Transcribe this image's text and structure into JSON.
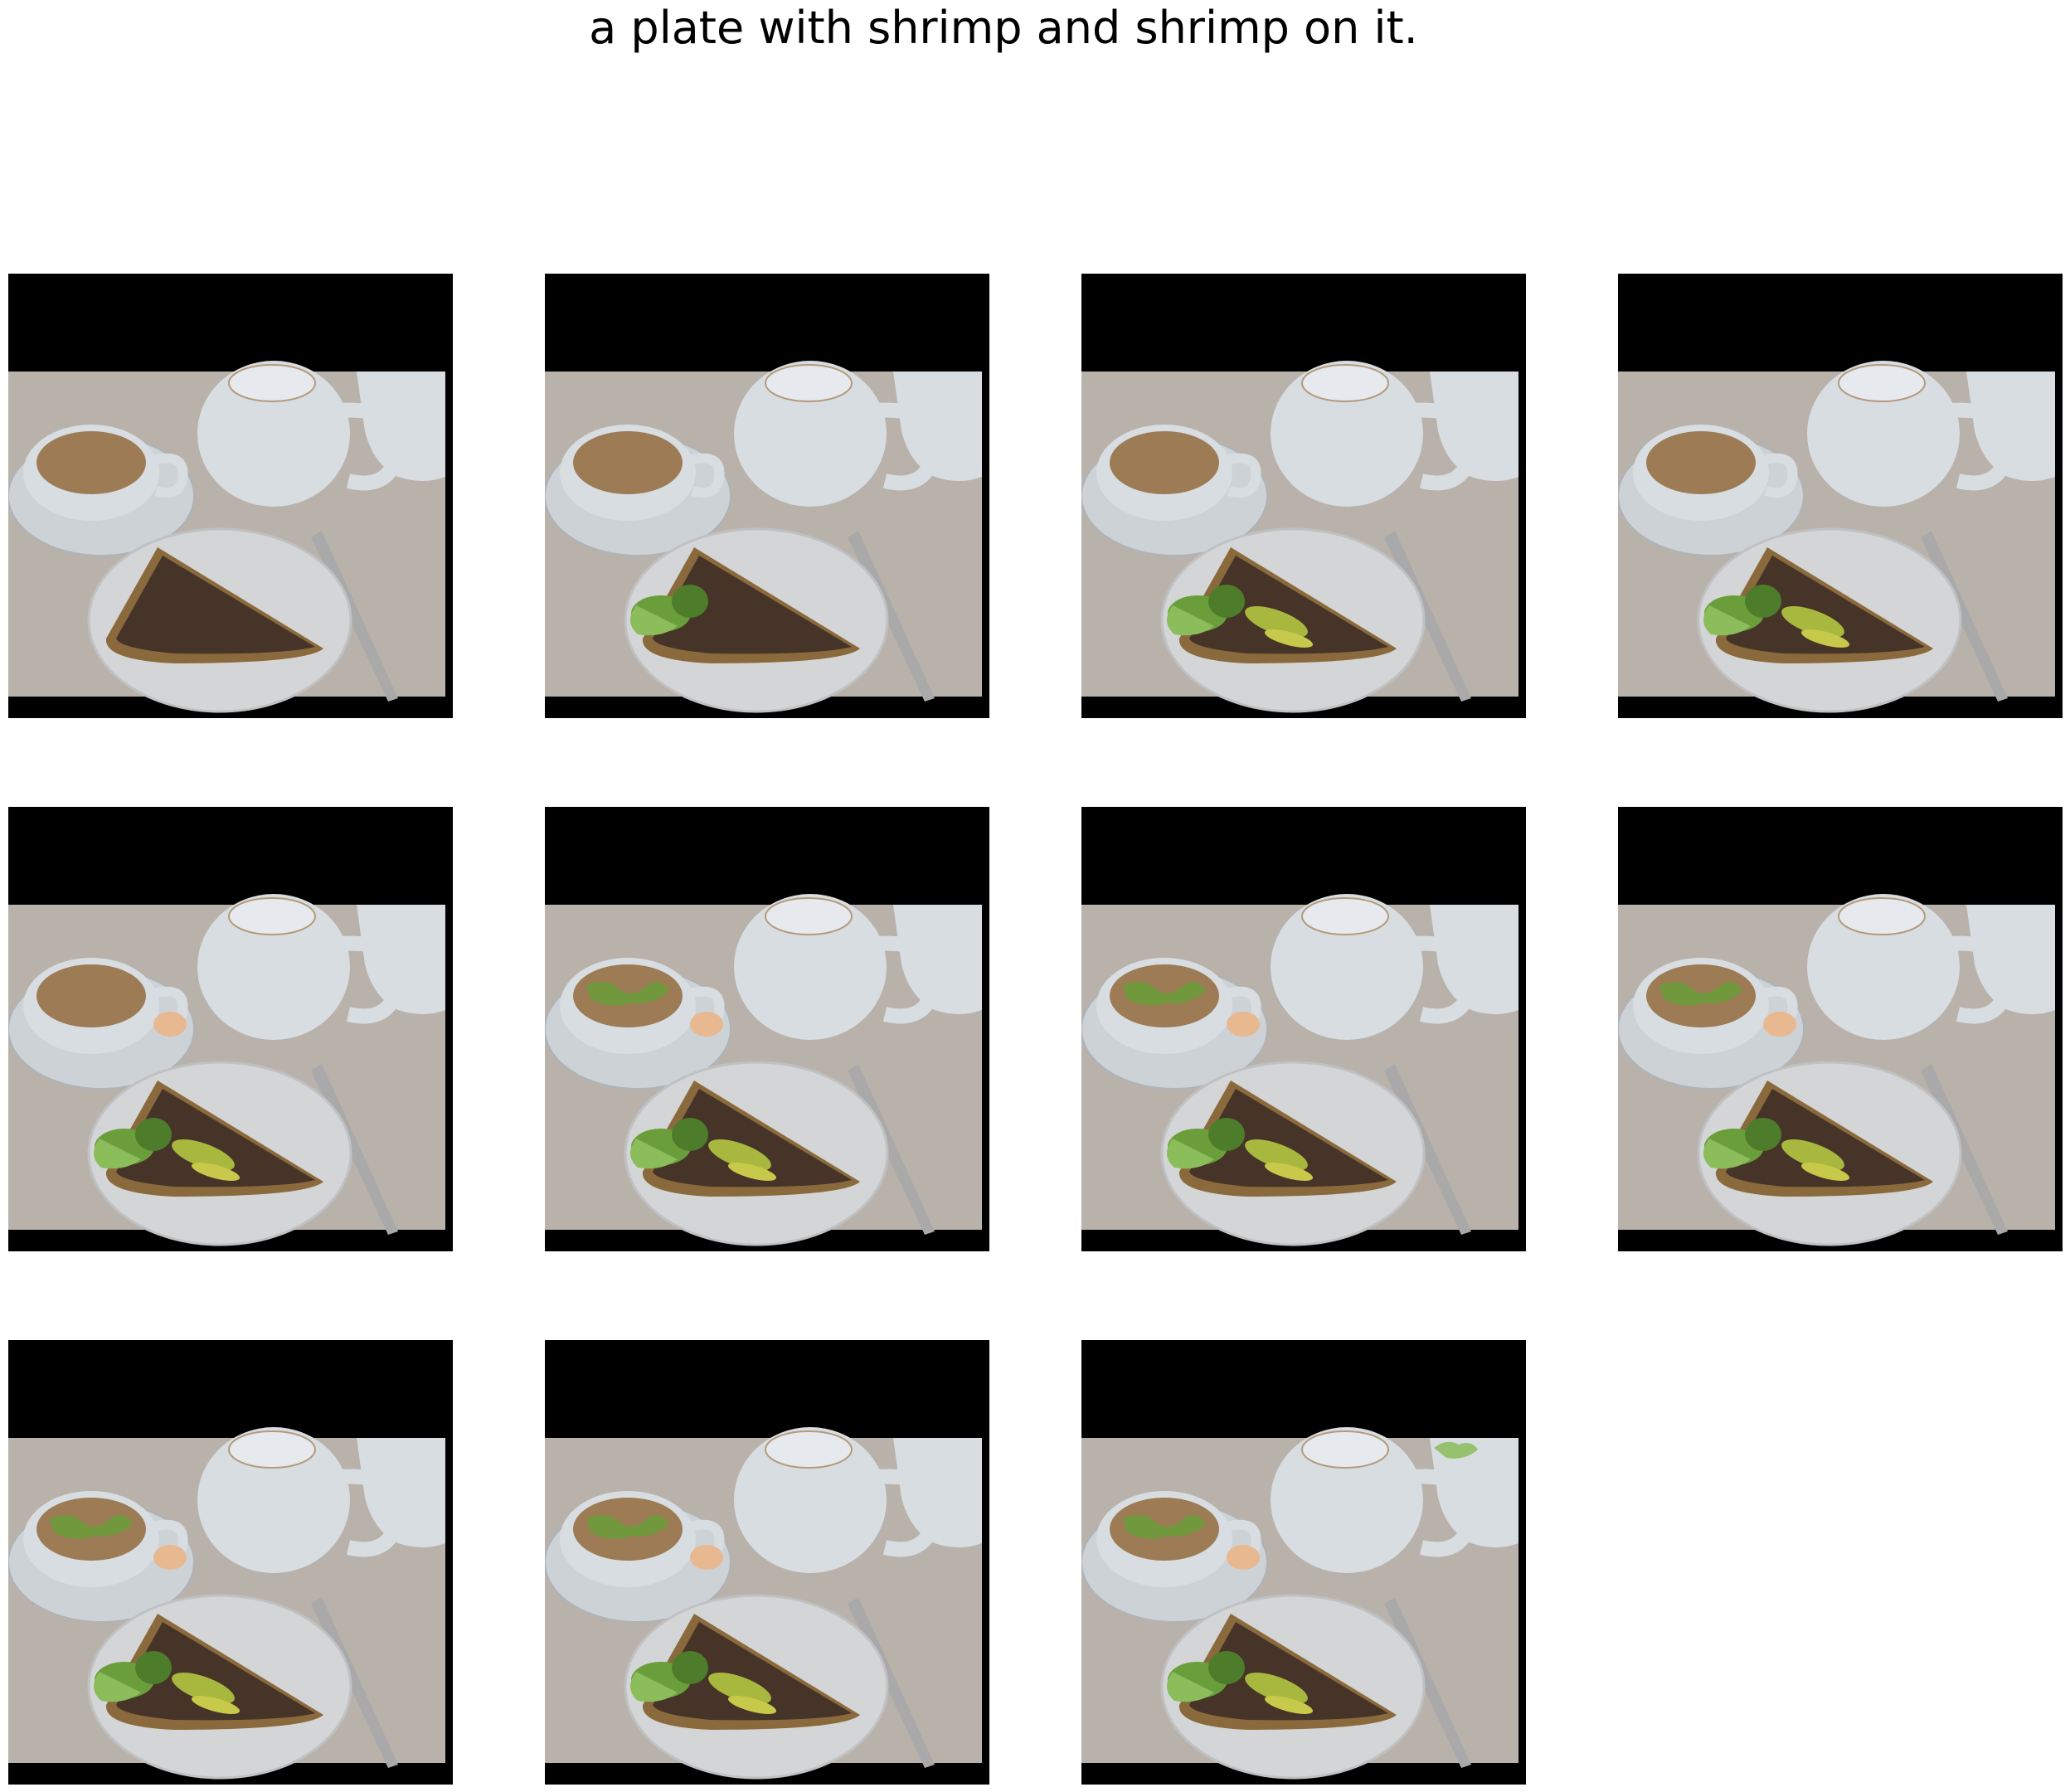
{
  "figure": {
    "title": "a plate with shrimp and shrimp on it.",
    "colors": {
      "background": "#ffffff",
      "padding": "#000000",
      "table": "#b9b2ab",
      "porcelain": "#d8dde2",
      "tea": "#9c7b55",
      "quiche_crust": "#8a6a3c",
      "quiche_dark": "#3a2a25",
      "broccoli": "#6a9e3a",
      "avocado": "#a8b83e",
      "shrimp": "#e8b890"
    }
  },
  "frames": [
    {
      "index": 1,
      "broccoli": false,
      "avocado": false,
      "cup_greens": false,
      "shrimp": false,
      "pot_greens": false
    },
    {
      "index": 2,
      "broccoli": true,
      "avocado": false,
      "cup_greens": false,
      "shrimp": false,
      "pot_greens": false
    },
    {
      "index": 3,
      "broccoli": true,
      "avocado": true,
      "cup_greens": false,
      "shrimp": false,
      "pot_greens": false
    },
    {
      "index": 4,
      "broccoli": true,
      "avocado": true,
      "cup_greens": false,
      "shrimp": false,
      "pot_greens": false
    },
    {
      "index": 5,
      "broccoli": true,
      "avocado": true,
      "cup_greens": false,
      "shrimp": true,
      "pot_greens": false
    },
    {
      "index": 6,
      "broccoli": true,
      "avocado": true,
      "cup_greens": true,
      "shrimp": true,
      "pot_greens": false
    },
    {
      "index": 7,
      "broccoli": true,
      "avocado": true,
      "cup_greens": true,
      "shrimp": true,
      "pot_greens": false
    },
    {
      "index": 8,
      "broccoli": true,
      "avocado": true,
      "cup_greens": true,
      "shrimp": true,
      "pot_greens": false
    },
    {
      "index": 9,
      "broccoli": true,
      "avocado": true,
      "cup_greens": true,
      "shrimp": true,
      "pot_greens": false
    },
    {
      "index": 10,
      "broccoli": true,
      "avocado": true,
      "cup_greens": true,
      "shrimp": true,
      "pot_greens": false
    },
    {
      "index": 11,
      "broccoli": true,
      "avocado": true,
      "cup_greens": true,
      "shrimp": true,
      "pot_greens": true
    }
  ]
}
